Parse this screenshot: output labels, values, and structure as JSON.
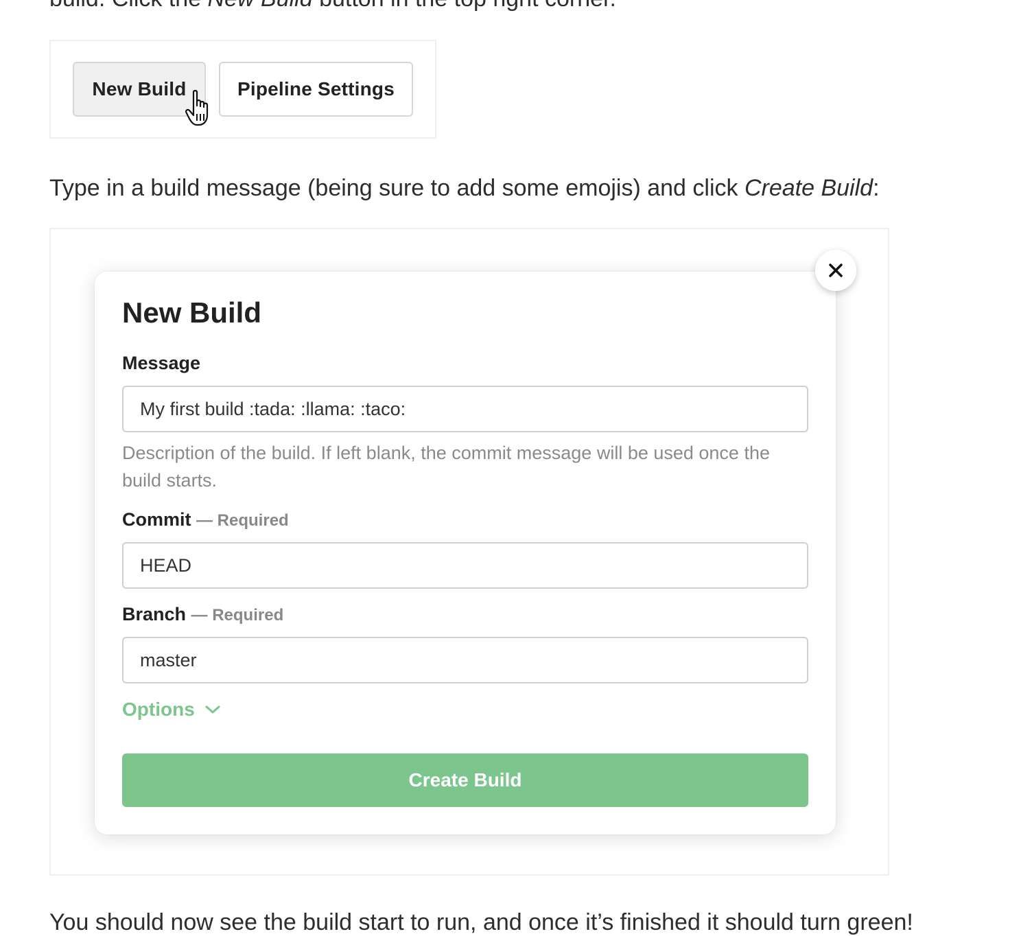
{
  "intro": {
    "before": "build. Click the ",
    "emphasis": "New Build",
    "after": " button in the top right corner."
  },
  "toolbar": {
    "new_build_label": "New Build",
    "pipeline_settings_label": "Pipeline Settings"
  },
  "instruction": {
    "before": "Type in a build message (being sure to add some emojis) and click ",
    "emphasis": "Create Build",
    "after": ":"
  },
  "modal": {
    "title": "New Build",
    "close_icon": "close-icon",
    "message": {
      "label": "Message",
      "value": "My first build :tada: :llama: :taco:",
      "help": "Description of the build. If left blank, the commit message will be used once the build starts."
    },
    "commit": {
      "label": "Commit",
      "required": "— Required",
      "value": "HEAD"
    },
    "branch": {
      "label": "Branch",
      "required": "— Required",
      "value": "master"
    },
    "options_label": "Options",
    "options_icon": "chevron-down-icon",
    "create_label": "Create Build",
    "accent_color": "#7cc68e"
  },
  "outro": "You should now see the build start to run, and once it’s finished it should turn green!"
}
